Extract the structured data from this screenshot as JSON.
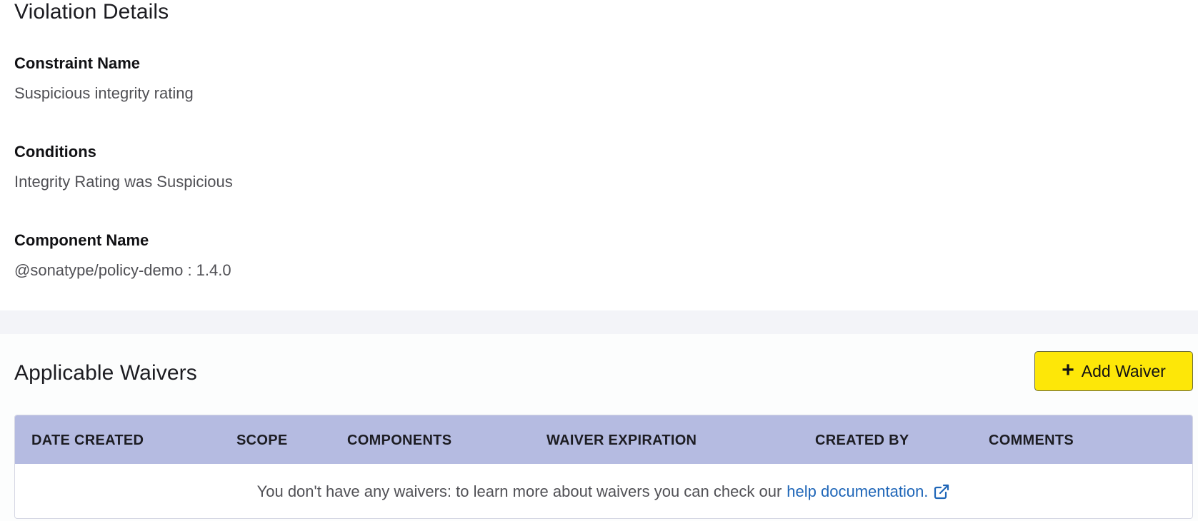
{
  "violation_details": {
    "title": "Violation Details",
    "constraint_name_label": "Constraint Name",
    "constraint_name_value": "Suspicious integrity rating",
    "conditions_label": "Conditions",
    "conditions_value": "Integrity Rating was Suspicious",
    "component_name_label": "Component Name",
    "component_name_value": "@sonatype/policy-demo : 1.4.0"
  },
  "waivers": {
    "title": "Applicable Waivers",
    "add_button": {
      "label": "Add Waiver",
      "icon": "plus-icon",
      "color": "#fde708"
    },
    "columns": [
      "DATE CREATED",
      "SCOPE",
      "COMPONENTS",
      "WAIVER EXPIRATION",
      "CREATED BY",
      "COMMENTS"
    ],
    "empty_text": "You don't have any waivers: to learn more about waivers you can check our",
    "help_link": {
      "label": "help documentation.",
      "icon": "external-link-icon",
      "color": "#1f66b8"
    },
    "header_color": "#b5bbe1"
  }
}
